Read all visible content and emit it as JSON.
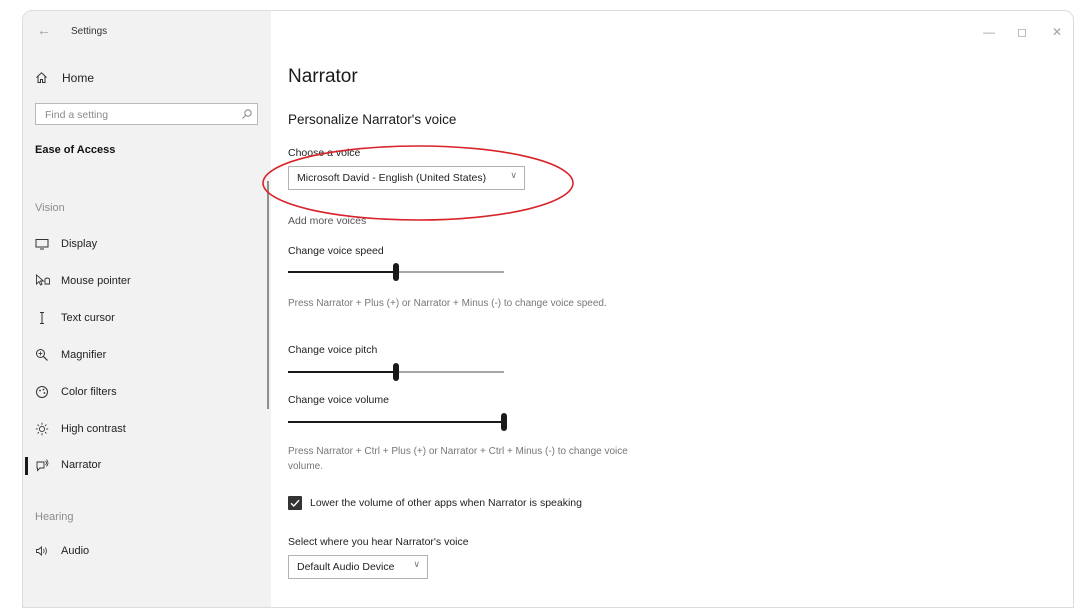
{
  "window": {
    "title": "Settings",
    "controls": {
      "minimize": "—",
      "maximize": "◻",
      "close": "✕"
    }
  },
  "sidebar": {
    "home_label": "Home",
    "search_placeholder": "Find a setting",
    "section_title": "Ease of Access",
    "groups": [
      {
        "label": "Vision"
      },
      {
        "label": "Hearing"
      }
    ],
    "items": [
      {
        "label": "Display",
        "icon": "display-icon"
      },
      {
        "label": "Mouse pointer",
        "icon": "mouse-pointer-icon"
      },
      {
        "label": "Text cursor",
        "icon": "text-cursor-icon"
      },
      {
        "label": "Magnifier",
        "icon": "magnifier-icon"
      },
      {
        "label": "Color filters",
        "icon": "color-filters-icon"
      },
      {
        "label": "High contrast",
        "icon": "high-contrast-icon"
      },
      {
        "label": "Narrator",
        "icon": "narrator-icon",
        "selected": true
      },
      {
        "label": "Audio",
        "icon": "audio-icon"
      }
    ]
  },
  "main": {
    "title": "Narrator",
    "subtitle": "Personalize Narrator's voice",
    "voice": {
      "label": "Choose a voice",
      "value": "Microsoft David - English (United States)"
    },
    "add_voices_link": "Add more voices",
    "speed": {
      "label": "Change voice speed",
      "value_percent": 50,
      "hint": "Press Narrator + Plus (+) or Narrator + Minus (-) to change voice speed."
    },
    "pitch": {
      "label": "Change voice pitch",
      "value_percent": 50
    },
    "volume": {
      "label": "Change voice volume",
      "value_percent": 100,
      "hint": "Press Narrator + Ctrl + Plus (+) or Narrator + Ctrl + Minus (-) to change voice volume."
    },
    "lower_volume": {
      "label": "Lower the volume of other apps when Narrator is speaking",
      "checked": true
    },
    "output": {
      "label": "Select where you hear Narrator's voice",
      "value": "Default Audio Device"
    }
  },
  "annotation": {
    "highlight_color": "#d8232a"
  }
}
